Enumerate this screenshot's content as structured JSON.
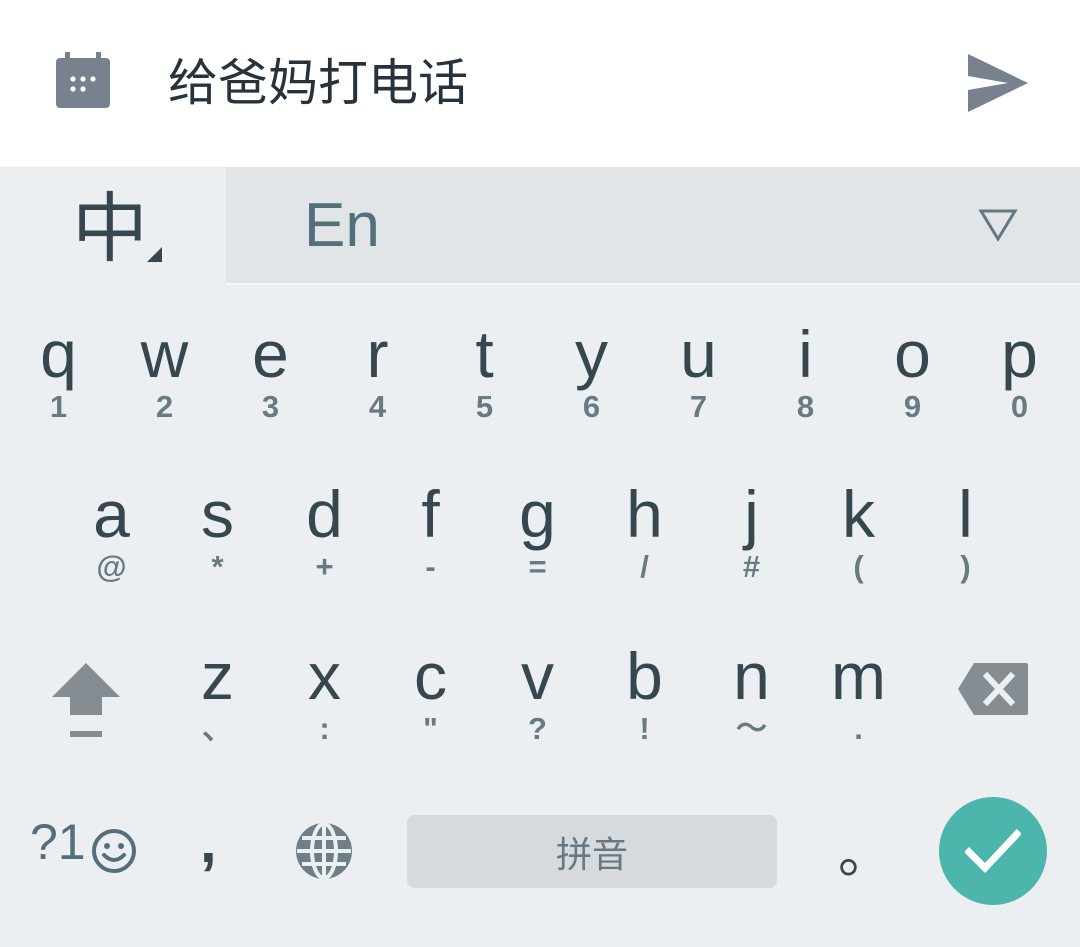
{
  "task_input": {
    "icon": "calendar-icon",
    "text": "给爸妈打电话",
    "send_icon": "send-icon"
  },
  "keyboard": {
    "language_bar": {
      "active": "中",
      "alternate": "En",
      "dropdown_icon": "triangle-down-icon"
    },
    "row1": [
      {
        "main": "q",
        "sub": "1"
      },
      {
        "main": "w",
        "sub": "2"
      },
      {
        "main": "e",
        "sub": "3"
      },
      {
        "main": "r",
        "sub": "4"
      },
      {
        "main": "t",
        "sub": "5"
      },
      {
        "main": "y",
        "sub": "6"
      },
      {
        "main": "u",
        "sub": "7"
      },
      {
        "main": "i",
        "sub": "8"
      },
      {
        "main": "o",
        "sub": "9"
      },
      {
        "main": "p",
        "sub": "0"
      }
    ],
    "row2": [
      {
        "main": "a",
        "sub": "@"
      },
      {
        "main": "s",
        "sub": "*"
      },
      {
        "main": "d",
        "sub": "+"
      },
      {
        "main": "f",
        "sub": "-"
      },
      {
        "main": "g",
        "sub": "="
      },
      {
        "main": "h",
        "sub": "/"
      },
      {
        "main": "j",
        "sub": "#"
      },
      {
        "main": "k",
        "sub": "("
      },
      {
        "main": "l",
        "sub": ")"
      }
    ],
    "row3": [
      {
        "main": "z",
        "sub": "、"
      },
      {
        "main": "x",
        "sub": ":"
      },
      {
        "main": "c",
        "sub": "\""
      },
      {
        "main": "v",
        "sub": "?"
      },
      {
        "main": "b",
        "sub": "!"
      },
      {
        "main": "n",
        "sub": "～"
      },
      {
        "main": "m",
        "sub": "."
      }
    ],
    "bottom_row": {
      "symbols_label": "?1",
      "comma": ",",
      "space_label": "拼音",
      "period": "。"
    },
    "accent_color": "#4db6ac"
  }
}
